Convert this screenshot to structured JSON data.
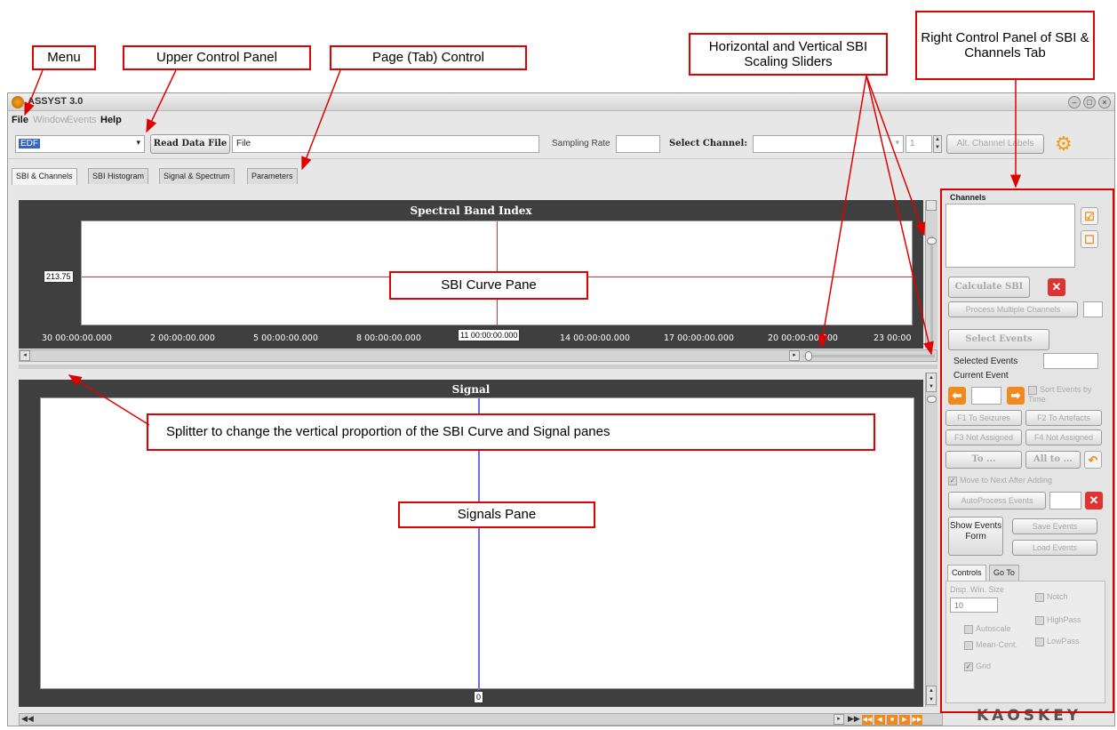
{
  "annotations": {
    "menu": "Menu",
    "upper_control_panel": "Upper Control Panel",
    "page_tab_control": "Page (Tab) Control",
    "sliders": "Horizontal and Vertical SBI Scaling Sliders",
    "right_panel": "Right Control Panel of SBI & Channels Tab",
    "sbi_curve_pane": "SBI Curve Pane",
    "splitter": "Splitter to change the vertical proportion of the SBI Curve and Signal panes",
    "signals_pane": "Signals Pane"
  },
  "window": {
    "title": "ASSYST 3.0"
  },
  "menu": {
    "items": [
      "File",
      "Window",
      "Events",
      "Help"
    ]
  },
  "toolbar": {
    "format_value": "EDF",
    "read_button": "Read Data File",
    "file_value": "File",
    "sampling_rate_label": "Sampling Rate",
    "select_channel_label": "Select Channel:",
    "channel_index": "1",
    "alt_labels_button": "Alt. Channel Labels"
  },
  "tabs": [
    "SBI & Channels",
    "SBI Histogram",
    "Signal & Spectrum",
    "Parameters"
  ],
  "sbi": {
    "title": "Spectral Band Index",
    "y_value": "213.75",
    "x_value": "11 00:00:00.000",
    "x_ticks": [
      "30 00:00:00.000",
      "2 00:00:00.000",
      "5 00:00:00.000",
      "8 00:00:00.000",
      "14 00:00:00.000",
      "17 00:00:00.000",
      "20 00:00:00.000",
      "23 00:00"
    ]
  },
  "signal": {
    "title": "Signal",
    "x_value": "0"
  },
  "right_panel": {
    "channels_label": "Channels",
    "calculate_sbi": "Calculate SBI",
    "process_multiple": "Process Multiple Channels",
    "select_events": "Select Events",
    "selected_events_label": "Selected Events",
    "current_event_label": "Current Event",
    "sort_events_label": "Sort Events by Time",
    "f1": "F1 To Seizures",
    "f2": "F2 To Artefacts",
    "f3": "F3 Not Assigned",
    "f4": "F4 Not Assigned",
    "to_button": "To ...",
    "all_to_button": "All to ...",
    "move_next": "Move to Next After Adding",
    "autoprocess": "AutoProcess Events",
    "show_events_form": "Show Events Form",
    "save_events": "Save Events",
    "load_events": "Load Events",
    "sub_tabs": [
      "Controls",
      "Go To"
    ],
    "disp_win_size_label": "Disp. Win. Size",
    "disp_win_size_value": "10",
    "autoscale": "Autoscale",
    "mean_cent": "Mean-Cent.",
    "grid": "Grid",
    "notch": "Notch",
    "highpass": "HighPass",
    "lowpass": "LowPass",
    "logo": "KAOSKEY"
  }
}
